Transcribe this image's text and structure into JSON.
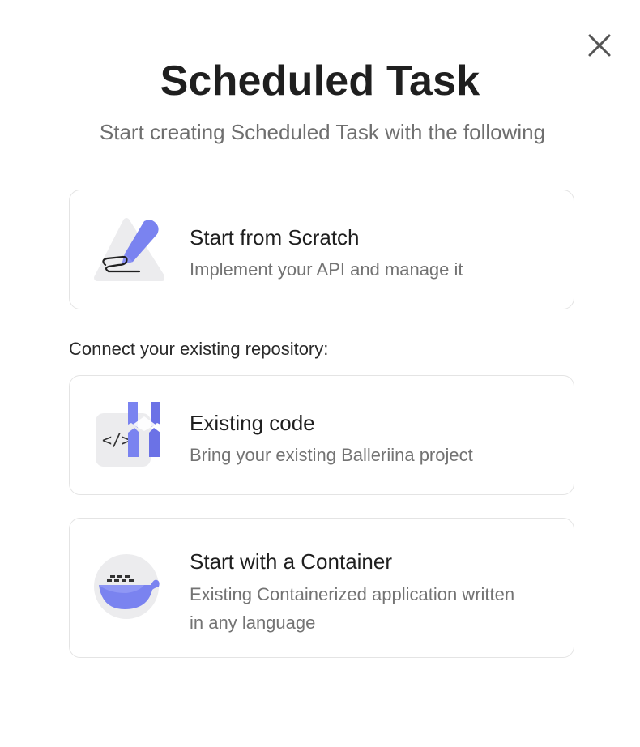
{
  "dialog": {
    "title": "Scheduled Task",
    "subtitle": "Start creating Scheduled Task with the following",
    "close_icon": "close-icon"
  },
  "options": [
    {
      "title": "Start from Scratch",
      "description": "Implement your API and manage it",
      "icon": "pencil-icon"
    }
  ],
  "repository_section": {
    "label": "Connect your existing repository:",
    "options": [
      {
        "title": "Existing code",
        "description": "Bring your existing Balleriina project",
        "icon": "code-icon"
      },
      {
        "title": "Start with a Container",
        "description": "Existing Containerized application written in any language",
        "icon": "container-whale-icon"
      }
    ]
  },
  "colors": {
    "accent": "#7a83f0",
    "accent_dark": "#6b72e6",
    "icon_bg": "#ececee",
    "border": "#e4e4e4",
    "title_text": "#1f1f1f",
    "muted_text": "#737373"
  }
}
